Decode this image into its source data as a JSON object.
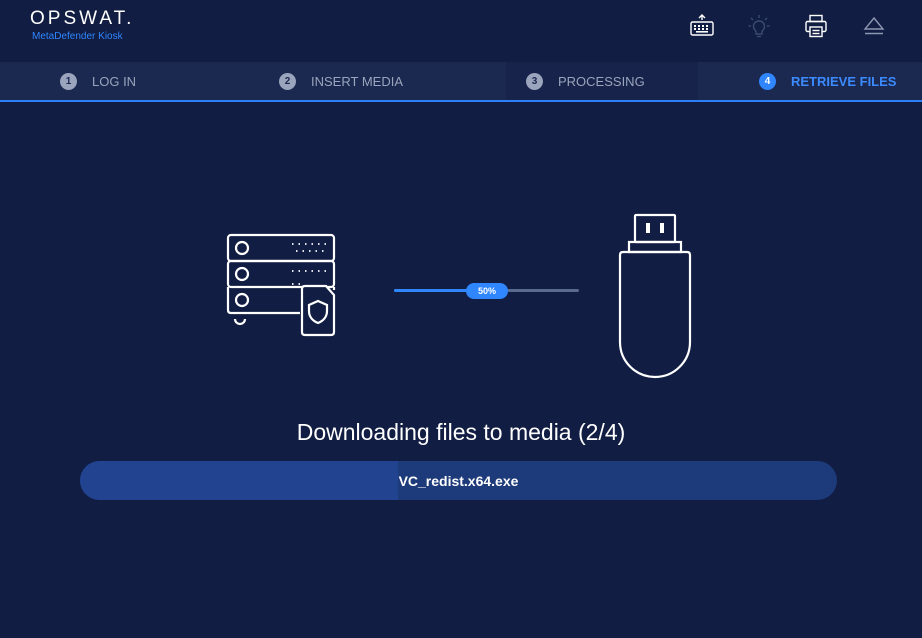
{
  "brand": {
    "name": "OPSWAT.",
    "product": "MetaDefender Kiosk"
  },
  "header_icons": [
    "keyboard-icon",
    "lightbulb-icon",
    "printer-icon",
    "eject-icon"
  ],
  "steps": [
    {
      "number": "1",
      "label": "LOG IN",
      "state": "done"
    },
    {
      "number": "2",
      "label": "INSERT MEDIA",
      "state": "done"
    },
    {
      "number": "3",
      "label": "PROCESSING",
      "state": "done"
    },
    {
      "number": "4",
      "label": "RETRIEVE FILES",
      "state": "active"
    }
  ],
  "transfer": {
    "progress_percent": 50,
    "progress_label": "50%"
  },
  "status": {
    "message": "Downloading files to media (2/4)"
  },
  "current_file": {
    "name": "VC_redist.x64.exe",
    "progress_percent": 42
  },
  "colors": {
    "background": "#111d42",
    "steps_bar": "#1b2850",
    "accent": "#2f86ff",
    "file_bar": "#1d3a7a"
  }
}
